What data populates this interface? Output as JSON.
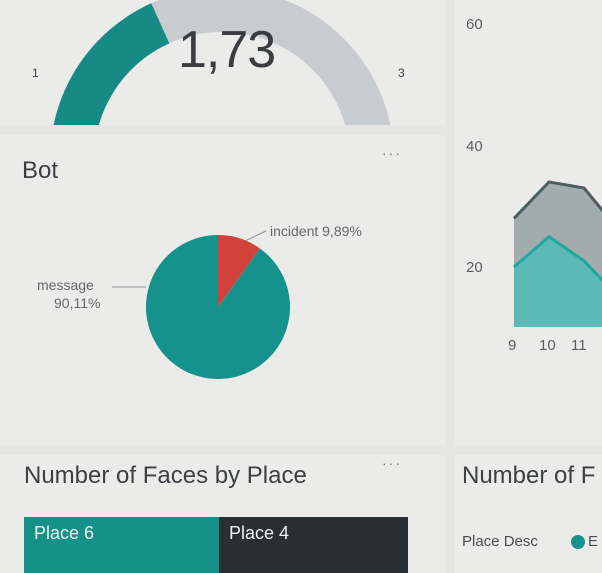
{
  "gauge": {
    "value": "1,73",
    "min": "1",
    "max": "3",
    "fill_fraction": 0.365,
    "fill_color": "#178a86",
    "track_color": "#c9ccce"
  },
  "bot_tile": {
    "title": "Bot",
    "more_icon": "more-options-icon"
  },
  "pie": {
    "chart_data": {
      "type": "pie",
      "slices": [
        {
          "name": "message",
          "value": 90.11,
          "color": "#15928b"
        },
        {
          "name": "incident",
          "value": 9.89,
          "color": "#d1423a"
        }
      ]
    },
    "labels": {
      "message_name": "message",
      "message_pct": "90,11%",
      "incident": "incident 9,89%"
    }
  },
  "right_chart": {
    "chart_data": {
      "type": "area",
      "y_ticks": [
        "60",
        "40",
        "20"
      ],
      "x_ticks": [
        "9",
        "10",
        "11"
      ],
      "ylim": [
        0,
        70
      ],
      "series": [
        {
          "x": [
            9,
            10,
            11,
            12
          ],
          "values": [
            28,
            34,
            33,
            26
          ],
          "color": "#4d5e5f"
        },
        {
          "x": [
            9,
            10,
            11,
            12
          ],
          "values": [
            20,
            25,
            21,
            15
          ],
          "color": "#22a7a0"
        }
      ]
    }
  },
  "faces_tile": {
    "title": "Number of Faces by Place",
    "more_icon": "more-options-icon",
    "cells": [
      {
        "label": "Place 6",
        "color": "#15918a"
      },
      {
        "label": "Place 4",
        "color": "#2b2f33"
      }
    ]
  },
  "right_tile": {
    "title": "Number of F",
    "legend_label": "Place Desc",
    "legend_item": "E",
    "legend_color": "#15928b"
  }
}
